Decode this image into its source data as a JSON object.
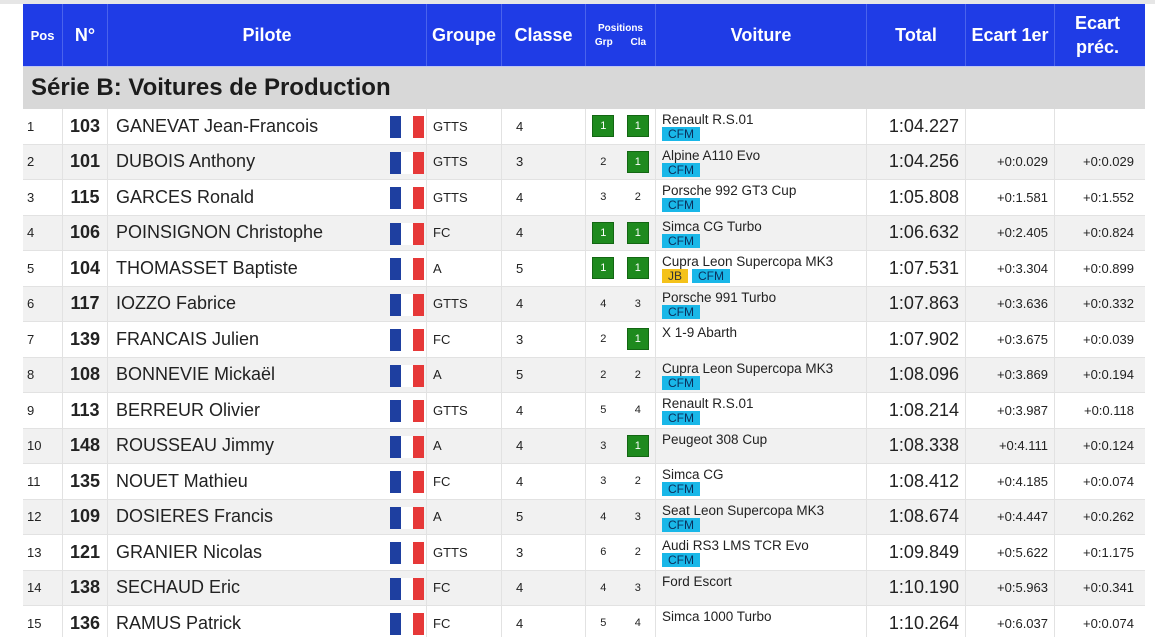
{
  "header": {
    "pos": "Pos",
    "num": "N°",
    "pilote": "Pilote",
    "groupe": "Groupe",
    "classe": "Classe",
    "positions": "Positions",
    "grp": "Grp",
    "cla": "Cla",
    "voiture": "Voiture",
    "total": "Total",
    "ecart_1er": "Ecart 1er",
    "ecart_prec_line1": "Ecart",
    "ecart_prec_line2": "préc."
  },
  "series_title": "Série B: Voitures de Production",
  "flag_colors": [
    "#1e3fa0",
    "#ffffff",
    "#e63838"
  ],
  "rows": [
    {
      "pos": "1",
      "num": "103",
      "pilote": "GANEVAT Jean-Francois",
      "groupe": "GTTS",
      "classe": "4",
      "grp": "1",
      "cla": "1",
      "grp_win": true,
      "cla_win": true,
      "voiture": "Renault R.S.01",
      "tags": [
        "CFM"
      ],
      "total": "1:04.227",
      "ecart1": "",
      "ecartp": ""
    },
    {
      "pos": "2",
      "num": "101",
      "pilote": "DUBOIS Anthony",
      "groupe": "GTTS",
      "classe": "3",
      "grp": "2",
      "cla": "1",
      "grp_win": false,
      "cla_win": true,
      "voiture": "Alpine A110 Evo",
      "tags": [
        "CFM"
      ],
      "total": "1:04.256",
      "ecart1": "+0:0.029",
      "ecartp": "+0:0.029"
    },
    {
      "pos": "3",
      "num": "115",
      "pilote": "GARCES Ronald",
      "groupe": "GTTS",
      "classe": "4",
      "grp": "3",
      "cla": "2",
      "grp_win": false,
      "cla_win": false,
      "voiture": "Porsche 992 GT3 Cup",
      "tags": [
        "CFM"
      ],
      "total": "1:05.808",
      "ecart1": "+0:1.581",
      "ecartp": "+0:1.552"
    },
    {
      "pos": "4",
      "num": "106",
      "pilote": "POINSIGNON Christophe",
      "groupe": "FC",
      "classe": "4",
      "grp": "1",
      "cla": "1",
      "grp_win": true,
      "cla_win": true,
      "voiture": "Simca CG Turbo",
      "tags": [
        "CFM"
      ],
      "total": "1:06.632",
      "ecart1": "+0:2.405",
      "ecartp": "+0:0.824"
    },
    {
      "pos": "5",
      "num": "104",
      "pilote": "THOMASSET Baptiste",
      "groupe": "A",
      "classe": "5",
      "grp": "1",
      "cla": "1",
      "grp_win": true,
      "cla_win": true,
      "voiture": "Cupra Leon Supercopa MK3",
      "tags": [
        "JB",
        "CFM"
      ],
      "total": "1:07.531",
      "ecart1": "+0:3.304",
      "ecartp": "+0:0.899"
    },
    {
      "pos": "6",
      "num": "117",
      "pilote": "IOZZO Fabrice",
      "groupe": "GTTS",
      "classe": "4",
      "grp": "4",
      "cla": "3",
      "grp_win": false,
      "cla_win": false,
      "voiture": "Porsche 991 Turbo",
      "tags": [
        "CFM"
      ],
      "total": "1:07.863",
      "ecart1": "+0:3.636",
      "ecartp": "+0:0.332"
    },
    {
      "pos": "7",
      "num": "139",
      "pilote": "FRANCAIS Julien",
      "groupe": "FC",
      "classe": "3",
      "grp": "2",
      "cla": "1",
      "grp_win": false,
      "cla_win": true,
      "voiture": "X 1-9 Abarth",
      "tags": [],
      "total": "1:07.902",
      "ecart1": "+0:3.675",
      "ecartp": "+0:0.039"
    },
    {
      "pos": "8",
      "num": "108",
      "pilote": "BONNEVIE Mickaël",
      "groupe": "A",
      "classe": "5",
      "grp": "2",
      "cla": "2",
      "grp_win": false,
      "cla_win": false,
      "voiture": "Cupra Leon Supercopa MK3",
      "tags": [
        "CFM"
      ],
      "total": "1:08.096",
      "ecart1": "+0:3.869",
      "ecartp": "+0:0.194"
    },
    {
      "pos": "9",
      "num": "113",
      "pilote": "BERREUR Olivier",
      "groupe": "GTTS",
      "classe": "4",
      "grp": "5",
      "cla": "4",
      "grp_win": false,
      "cla_win": false,
      "voiture": "Renault R.S.01",
      "tags": [
        "CFM"
      ],
      "total": "1:08.214",
      "ecart1": "+0:3.987",
      "ecartp": "+0:0.118"
    },
    {
      "pos": "10",
      "num": "148",
      "pilote": "ROUSSEAU Jimmy",
      "groupe": "A",
      "classe": "4",
      "grp": "3",
      "cla": "1",
      "grp_win": false,
      "cla_win": true,
      "voiture": "Peugeot 308 Cup",
      "tags": [],
      "total": "1:08.338",
      "ecart1": "+0:4.111",
      "ecartp": "+0:0.124"
    },
    {
      "pos": "11",
      "num": "135",
      "pilote": "NOUET Mathieu",
      "groupe": "FC",
      "classe": "4",
      "grp": "3",
      "cla": "2",
      "grp_win": false,
      "cla_win": false,
      "voiture": "Simca CG",
      "tags": [
        "CFM"
      ],
      "total": "1:08.412",
      "ecart1": "+0:4.185",
      "ecartp": "+0:0.074"
    },
    {
      "pos": "12",
      "num": "109",
      "pilote": "DOSIERES Francis",
      "groupe": "A",
      "classe": "5",
      "grp": "4",
      "cla": "3",
      "grp_win": false,
      "cla_win": false,
      "voiture": "Seat Leon Supercopa MK3",
      "tags": [
        "CFM"
      ],
      "total": "1:08.674",
      "ecart1": "+0:4.447",
      "ecartp": "+0:0.262"
    },
    {
      "pos": "13",
      "num": "121",
      "pilote": "GRANIER Nicolas",
      "groupe": "GTTS",
      "classe": "3",
      "grp": "6",
      "cla": "2",
      "grp_win": false,
      "cla_win": false,
      "voiture": "Audi RS3 LMS TCR Evo",
      "tags": [
        "CFM"
      ],
      "total": "1:09.849",
      "ecart1": "+0:5.622",
      "ecartp": "+0:1.175"
    },
    {
      "pos": "14",
      "num": "138",
      "pilote": "SECHAUD Eric",
      "groupe": "FC",
      "classe": "4",
      "grp": "4",
      "cla": "3",
      "grp_win": false,
      "cla_win": false,
      "voiture": "Ford Escort",
      "tags": [],
      "total": "1:10.190",
      "ecart1": "+0:5.963",
      "ecartp": "+0:0.341"
    },
    {
      "pos": "15",
      "num": "136",
      "pilote": "RAMUS Patrick",
      "groupe": "FC",
      "classe": "4",
      "grp": "5",
      "cla": "4",
      "grp_win": false,
      "cla_win": false,
      "voiture": "Simca 1000 Turbo",
      "tags": [],
      "total": "1:10.264",
      "ecart1": "+0:6.037",
      "ecartp": "+0:0.074"
    }
  ]
}
